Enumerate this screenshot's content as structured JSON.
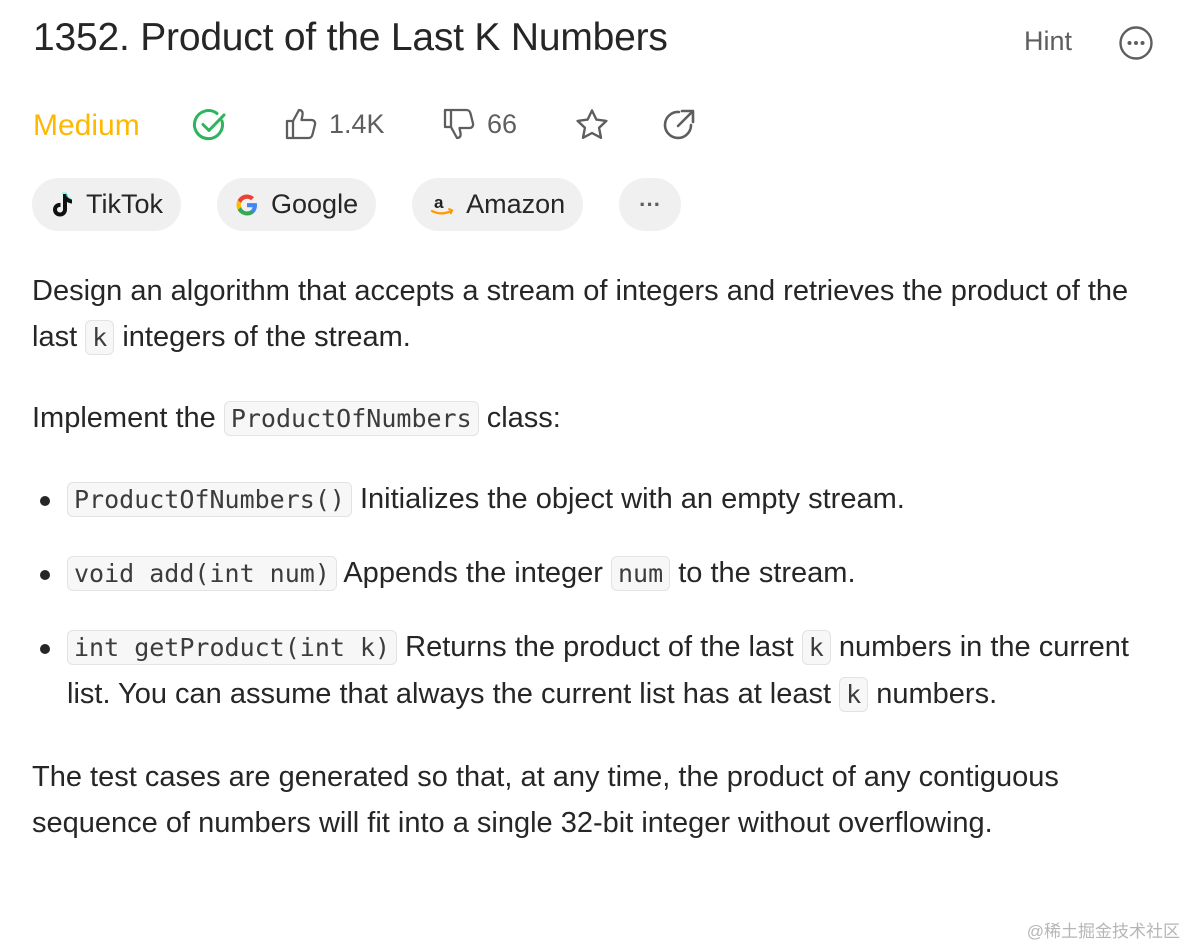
{
  "problem": {
    "title": "1352. Product of the Last K Numbers",
    "hint_label": "Hint",
    "difficulty": "Medium",
    "difficulty_color": "#ffb800",
    "likes": "1.4K",
    "dislikes": "66"
  },
  "tags": [
    {
      "label": "TikTok",
      "icon": "tiktok-logo"
    },
    {
      "label": "Google",
      "icon": "google-logo"
    },
    {
      "label": "Amazon",
      "icon": "amazon-logo"
    },
    {
      "label": "···",
      "icon": "more-icon"
    }
  ],
  "description": {
    "p1_a": "Design an algorithm that accepts a stream of integers and retrieves the product of the last",
    "p1_code": "k",
    "p1_b": "integers of the stream.",
    "p2_a": "Implement the",
    "p2_code": "ProductOfNumbers",
    "p2_b": "class:",
    "items": [
      {
        "code": "ProductOfNumbers()",
        "text_a": "Initializes the object with an empty stream."
      },
      {
        "code": "void add(int num)",
        "text_a": "Appends the integer",
        "code2": "num",
        "text_b": "to the stream."
      },
      {
        "code": "int getProduct(int k)",
        "text_a": "Returns the product of the last",
        "code2": "k",
        "text_b": "numbers in the current list. You can assume that always the current list has at least",
        "code3": "k",
        "text_c": "numbers."
      }
    ],
    "p3": "The test cases are generated so that, at any time, the product of any contiguous sequence of numbers will fit into a single 32-bit integer without overflowing."
  },
  "watermark": "@稀土掘金技术社区"
}
